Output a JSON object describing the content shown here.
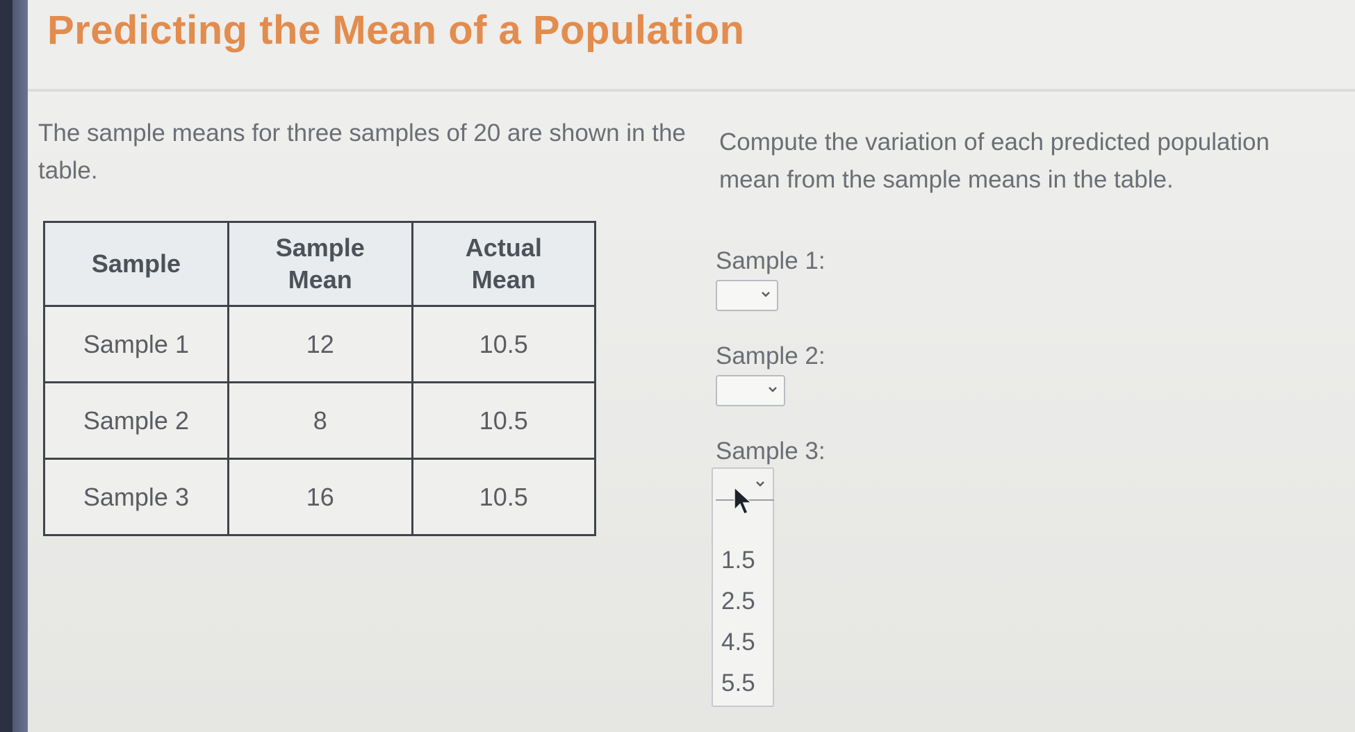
{
  "header": {
    "title": "Predicting the Mean of a Population"
  },
  "intro": "The sample means for three samples of 20 are shown in the table.",
  "instruction": "Compute the variation of each predicted population mean from the sample means in the table.",
  "table": {
    "headers": [
      "Sample",
      "Sample Mean",
      "Actual Mean"
    ],
    "rows": [
      [
        "Sample 1",
        "12",
        "10.5"
      ],
      [
        "Sample 2",
        "8",
        "10.5"
      ],
      [
        "Sample 3",
        "16",
        "10.5"
      ]
    ]
  },
  "questions": [
    {
      "label": "Sample 1:",
      "value": ""
    },
    {
      "label": "Sample 2:",
      "value": ""
    },
    {
      "label": "Sample 3:",
      "value": ""
    }
  ],
  "dropdown_options": [
    "1.5",
    "2.5",
    "4.5",
    "5.5"
  ],
  "colors": {
    "title": "#e28c4e",
    "text": "#6b6e73",
    "table_border": "#3f444c",
    "header_bg": "#e8ecee"
  },
  "icons": {
    "select_chevron": "chevron-down-icon",
    "pointer": "cursor-arrow-icon"
  }
}
